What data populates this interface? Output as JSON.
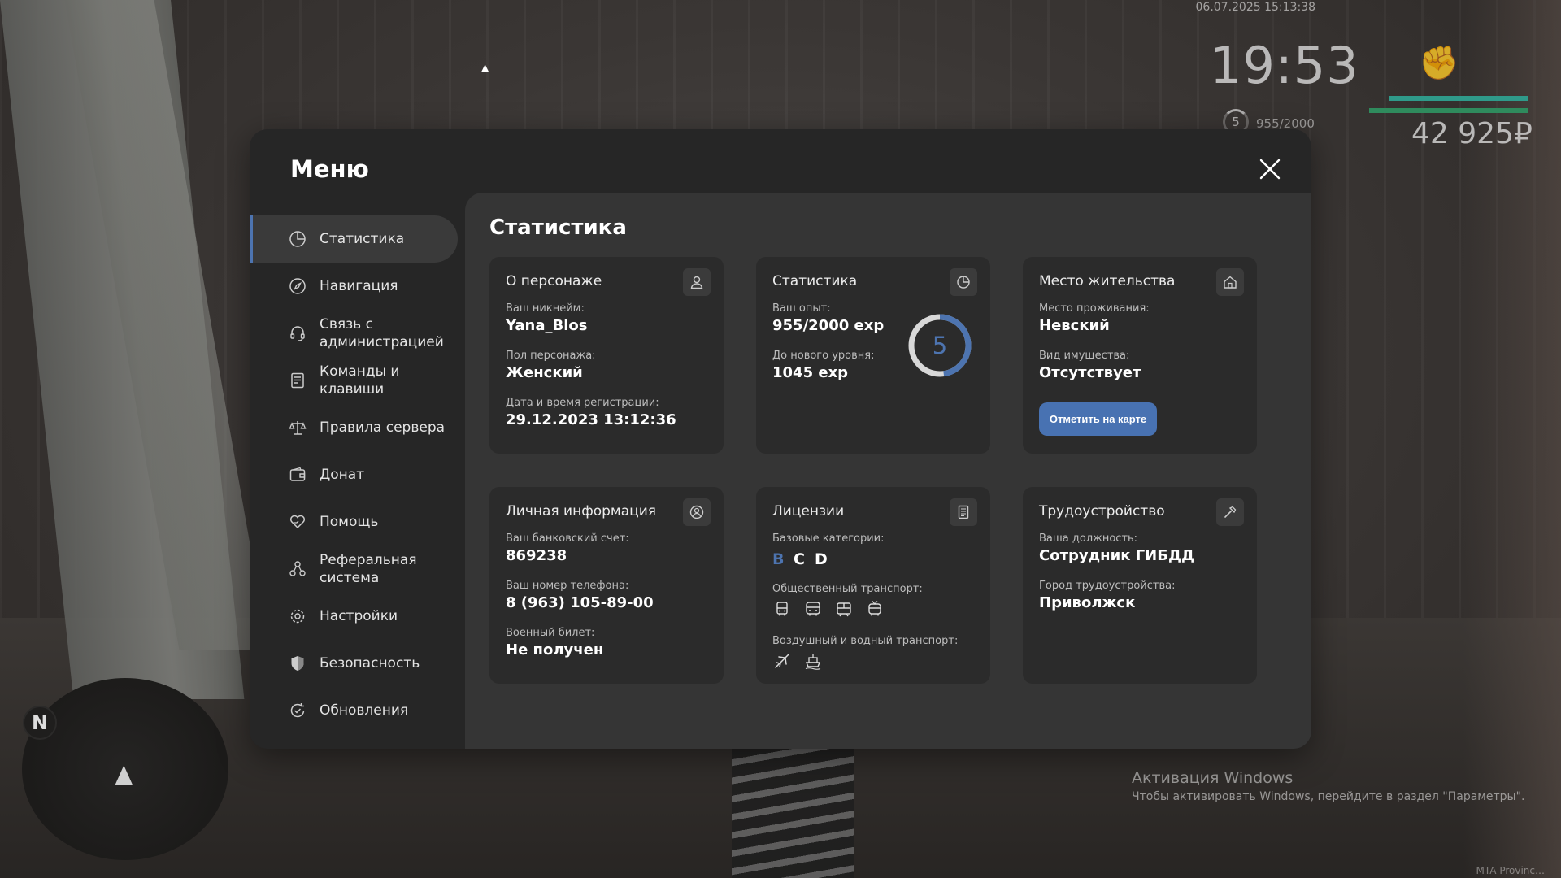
{
  "hud": {
    "datetime": "06.07.2025 15:13:38",
    "time": "19:53",
    "level": "5",
    "exp": "955/2000",
    "money": "42 925₽"
  },
  "radar": {
    "north": "N"
  },
  "windows_watermark": {
    "title": "Активация Windows",
    "subtitle": "Чтобы активировать Windows, перейдите в раздел \"Параметры\"."
  },
  "mta_tag": "MTA Provinc…",
  "menu": {
    "title": "Меню",
    "sidebar": [
      {
        "label": "Статистика",
        "icon": "pie-chart-icon",
        "active": true
      },
      {
        "label": "Навигация",
        "icon": "compass-icon"
      },
      {
        "label": "Связь с администрацией",
        "icon": "headset-icon"
      },
      {
        "label": "Команды и клавиши",
        "icon": "document-icon"
      },
      {
        "label": "Правила сервера",
        "icon": "scales-icon"
      },
      {
        "label": "Донат",
        "icon": "wallet-icon"
      },
      {
        "label": "Помощь",
        "icon": "heart-hand-icon"
      },
      {
        "label": "Реферальная система",
        "icon": "network-icon"
      },
      {
        "label": "Настройки",
        "icon": "gear-icon"
      },
      {
        "label": "Безопасность",
        "icon": "shield-icon"
      },
      {
        "label": "Обновления",
        "icon": "refresh-check-icon"
      }
    ],
    "section_title": "Статистика",
    "cards": {
      "character": {
        "title": "О персонаже",
        "nickname_label": "Ваш никнейм:",
        "nickname": "Yana_Blos",
        "gender_label": "Пол персонажа:",
        "gender": "Женский",
        "reg_label": "Дата и время регистрации:",
        "reg_value": "29.12.2023 13:12:36"
      },
      "stats": {
        "title": "Статистика",
        "exp_label": "Ваш опыт:",
        "exp_value": "955/2000 exp",
        "next_label": "До нового уровня:",
        "next_value": "1045 exp",
        "level": "5",
        "progress": 0.4775
      },
      "residence": {
        "title": "Место жительства",
        "place_label": "Место проживания:",
        "place_value": "Невский",
        "property_label": "Вид имущества:",
        "property_value": "Отсутствует",
        "button": "Отметить на карте"
      },
      "personal": {
        "title": "Личная информация",
        "bank_label": "Ваш банковский счет:",
        "bank_value": "869238",
        "phone_label": "Ваш номер телефона:",
        "phone_value": "8 (963) 105-89-00",
        "military_label": "Военный билет:",
        "military_value": "Не получен"
      },
      "licenses": {
        "title": "Лицензии",
        "base_label": "Базовые категории:",
        "categories": [
          {
            "name": "B",
            "color": "#4d74b0"
          },
          {
            "name": "C",
            "color": "#ffffff"
          },
          {
            "name": "D",
            "color": "#ffffff"
          }
        ],
        "public_label": "Общественный транспорт:",
        "public_icons": [
          "bus-icon",
          "coach-icon",
          "tram-icon",
          "trolleybus-icon"
        ],
        "air_label": "Воздушный и водный транспорт:",
        "air_icons": [
          "plane-icon",
          "boat-icon"
        ]
      },
      "job": {
        "title": "Трудоустройство",
        "position_label": "Ваша должность:",
        "position_value": "Сотрудник ГИБДД",
        "city_label": "Город трудоустройства:",
        "city_value": "Приволжск"
      }
    }
  },
  "colors": {
    "accent": "#4d74b0",
    "panel": "#262626",
    "content": "#353535",
    "card": "#2b2b2b"
  }
}
